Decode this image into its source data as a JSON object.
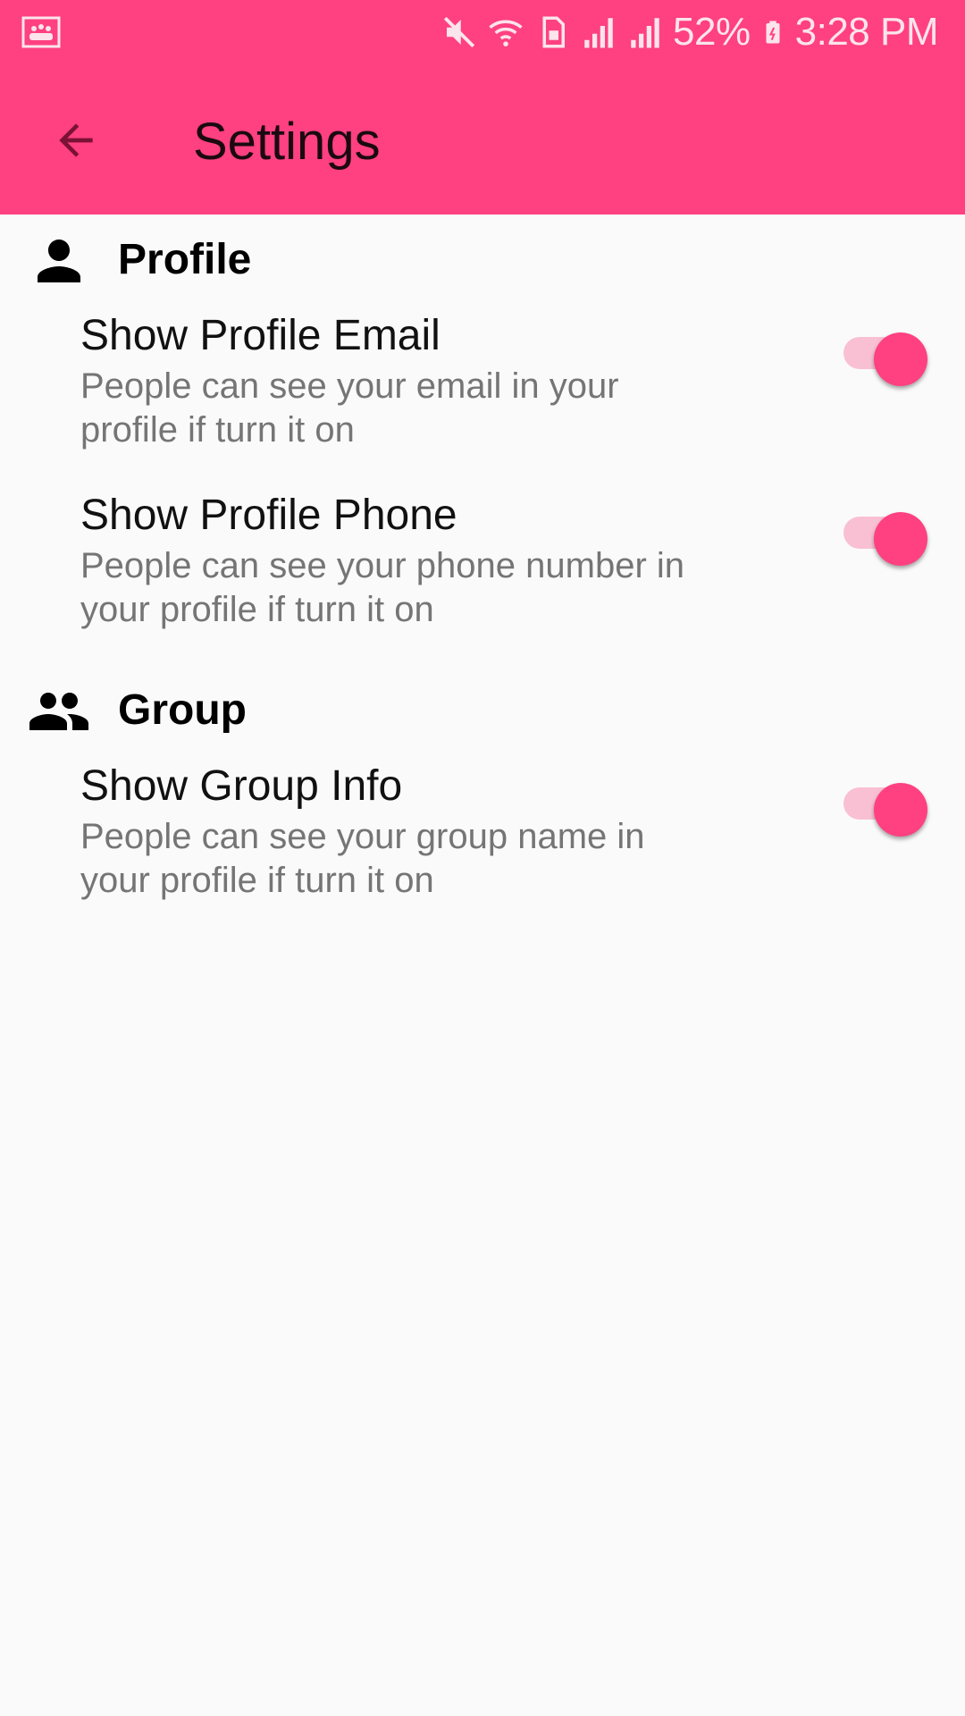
{
  "status_bar": {
    "battery": "52%",
    "time": "3:28 PM",
    "icons": [
      "gallery-notification-icon",
      "mute-icon",
      "wifi-icon",
      "sim-icon",
      "signal-icon",
      "signal-icon",
      "battery-charging-icon"
    ]
  },
  "app_bar": {
    "title": "Settings",
    "back_icon": "arrow-back-icon",
    "color": "#ff4081"
  },
  "sections": [
    {
      "title": "Profile",
      "icon": "person-icon",
      "items": [
        {
          "title": "Show Profile Email",
          "summary": "People can see your email in your profile if turn it on",
          "checked": true
        },
        {
          "title": "Show Profile Phone",
          "summary": "People can see your phone number in your profile if turn it on",
          "checked": true
        }
      ]
    },
    {
      "title": "Group",
      "icon": "group-icon",
      "items": [
        {
          "title": "Show Group Info",
          "summary": "People can see your group name in your profile if turn it on",
          "checked": true
        }
      ]
    }
  ],
  "colors": {
    "accent": "#ff4081",
    "switch_track": "#f9c0d4",
    "background": "#fafafa",
    "summary_text": "#757575"
  }
}
